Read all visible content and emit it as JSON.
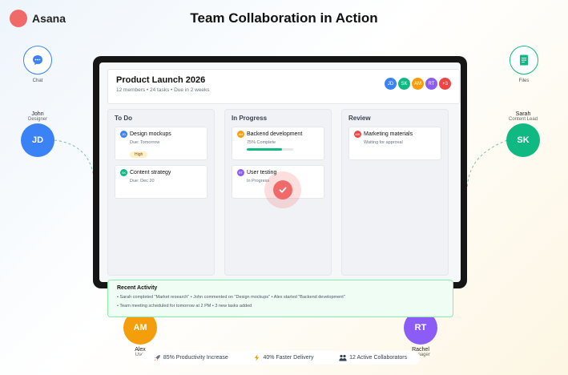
{
  "brand": {
    "name": "Asana",
    "color": "#f06a6a"
  },
  "page_title": "Team Collaboration in Action",
  "apps": {
    "chat": {
      "label": "Chat",
      "icon": "chat-bubble-icon",
      "color": "#3b82f6"
    },
    "files": {
      "label": "Files",
      "icon": "document-icon",
      "color": "#10b981"
    }
  },
  "people": {
    "john": {
      "name": "John",
      "role": "Designer",
      "initials": "JD",
      "color": "#3b82f6"
    },
    "sarah": {
      "name": "Sarah",
      "role": "Content Lead",
      "initials": "SK",
      "color": "#10b981"
    },
    "alex": {
      "name": "Alex",
      "role": "User",
      "initials": "AM",
      "color": "#f59e0b"
    },
    "rachel": {
      "name": "Rachel",
      "role": "Manager",
      "initials": "RT",
      "color": "#8b5cf6"
    }
  },
  "project": {
    "title": "Product Launch 2026",
    "meta": "12 members • 24 tasks • Due in 2 weeks",
    "members": [
      {
        "initials": "JD",
        "color": "#3b82f6"
      },
      {
        "initials": "SK",
        "color": "#10b981"
      },
      {
        "initials": "AM",
        "color": "#f59e0b"
      },
      {
        "initials": "RT",
        "color": "#8b5cf6"
      },
      {
        "initials": "+3",
        "color": "#ef4444"
      }
    ]
  },
  "board": {
    "todo": {
      "title": "To Do",
      "tasks": [
        {
          "title": "Design mockups",
          "sub": "Due: Tomorrow",
          "tag": "High",
          "assignee": "JD",
          "color": "#3b82f6"
        },
        {
          "title": "Content strategy",
          "sub": "Due: Dec 20",
          "assignee": "SK",
          "color": "#10b981"
        }
      ]
    },
    "in_progress": {
      "title": "In Progress",
      "tasks": [
        {
          "title": "Backend development",
          "sub": "75% Complete",
          "progress": 0.75,
          "assignee": "AM",
          "color": "#f59e0b"
        },
        {
          "title": "User testing",
          "sub": "In Progress",
          "assignee": "RT",
          "color": "#8b5cf6"
        }
      ]
    },
    "review": {
      "title": "Review",
      "tasks": [
        {
          "title": "Marketing materials",
          "sub": "Waiting for approval",
          "assignee": "MK",
          "color": "#ef4444"
        }
      ]
    }
  },
  "activity": {
    "title": "Recent Activity",
    "lines": [
      "• Sarah completed \"Market research\" • John commented on \"Design mockups\" • Alex started \"Backend development\"",
      "• Team meeting scheduled for tomorrow at 2 PM • 3 new tasks added"
    ]
  },
  "stats": [
    {
      "icon": "rocket-icon",
      "label": "85% Productivity Increase"
    },
    {
      "icon": "lightning-icon",
      "label": "40% Faster Delivery"
    },
    {
      "icon": "team-icon",
      "label": "12 Active Collaborators"
    }
  ]
}
